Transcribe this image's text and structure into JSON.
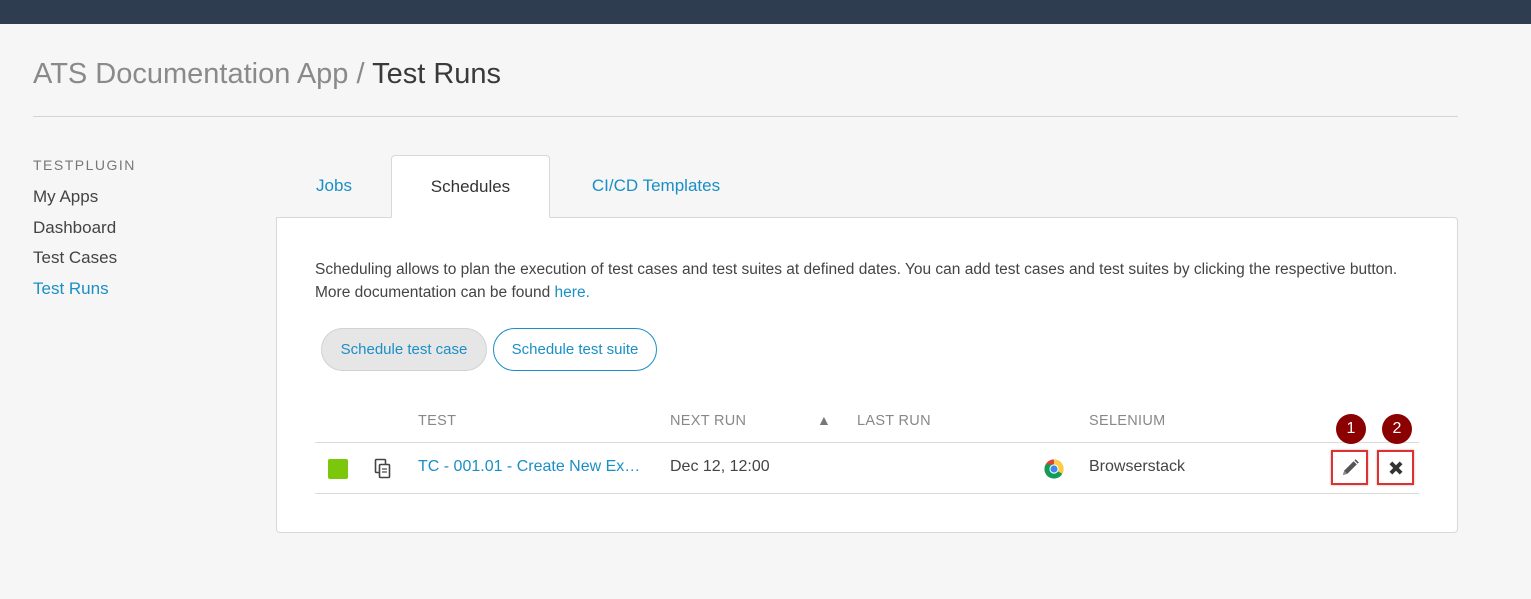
{
  "header": {
    "app_name": "ATS Documentation App",
    "separator": "/",
    "page_title": "Test Runs"
  },
  "sidebar": {
    "section_title": "TESTPLUGIN",
    "items": [
      {
        "label": "My Apps",
        "active": false
      },
      {
        "label": "Dashboard",
        "active": false
      },
      {
        "label": "Test Cases",
        "active": false
      },
      {
        "label": "Test Runs",
        "active": true
      }
    ]
  },
  "tabs": [
    {
      "label": "Jobs",
      "active": false
    },
    {
      "label": "Schedules",
      "active": true
    },
    {
      "label": "CI/CD Templates",
      "active": false
    }
  ],
  "panel": {
    "description": "Scheduling allows to plan the execution of test cases and test suites at defined dates. You can add test cases and test suites by clicking the respective button. More documentation can be found ",
    "description_link": "here.",
    "buttons": {
      "schedule_case": "Schedule test case",
      "schedule_suite": "Schedule test suite"
    }
  },
  "table": {
    "columns": {
      "test": "TEST",
      "next_run": "NEXT RUN",
      "sort_indicator": "▲",
      "last_run": "LAST RUN",
      "selenium": "SELENIUM"
    },
    "rows": [
      {
        "status": "success",
        "test": "TC - 001.01 - Create New Ex…",
        "next_run": "Dec 12, 12:00",
        "last_run": "",
        "browser_icon": "chrome-icon",
        "selenium": "Browserstack"
      }
    ]
  },
  "markers": {
    "edit": "1",
    "delete": "2"
  },
  "colors": {
    "accent": "#1a8fc6",
    "topbar": "#2e3d4f",
    "status_green": "#7ac70c",
    "highlight_red": "#e03030",
    "marker": "#8b0000"
  }
}
